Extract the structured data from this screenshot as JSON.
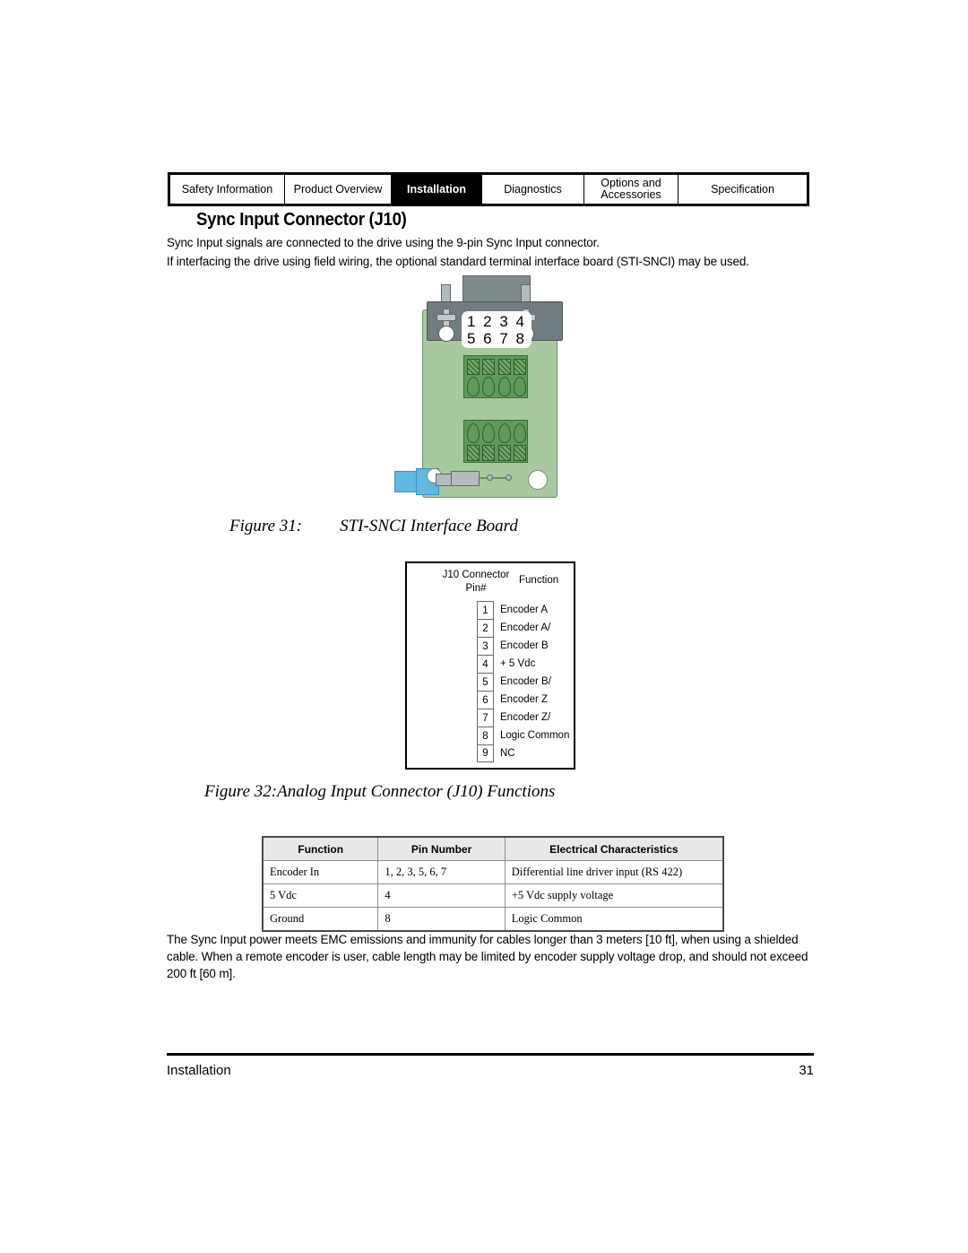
{
  "tabs": [
    {
      "label": "Safety Information",
      "active": false
    },
    {
      "label": "Product Overview",
      "active": false
    },
    {
      "label": "Installation",
      "active": true
    },
    {
      "label": "Diagnostics",
      "active": false
    },
    {
      "label": "Options and Accessories",
      "active": false
    },
    {
      "label": "Specification",
      "active": false
    }
  ],
  "heading": "Sync Input Connector (J10)",
  "intro": {
    "line1": "Sync Input signals are connected to the drive using the 9-pin Sync Input connector.",
    "line2": "If interfacing the drive using field wiring, the optional standard terminal interface board (STI-SNCI) may be used."
  },
  "pcb": {
    "pin_label_row1": "1 2 3 4",
    "pin_label_row2": "5 6 7 8"
  },
  "figure31": {
    "number": "Figure 31:",
    "title": "STI-SNCI Interface Board"
  },
  "figure32": {
    "caption": "Figure 32:Analog Input Connector (J10) Functions"
  },
  "pin_diagram": {
    "header_left_line1": "J10 Connector",
    "header_left_line2": "Pin#",
    "header_right": "Function",
    "rows": [
      {
        "pin": "1",
        "function": "Encoder A"
      },
      {
        "pin": "2",
        "function": "Encoder A/"
      },
      {
        "pin": "3",
        "function": "Encoder B"
      },
      {
        "pin": "4",
        "function": "+ 5 Vdc"
      },
      {
        "pin": "5",
        "function": "Encoder B/"
      },
      {
        "pin": "6",
        "function": "Encoder Z"
      },
      {
        "pin": "7",
        "function": "Encoder Z/"
      },
      {
        "pin": "8",
        "function": "Logic Common"
      },
      {
        "pin": "9",
        "function": "NC"
      }
    ]
  },
  "table": {
    "headers": [
      "Function",
      "Pin Number",
      "Electrical Characteristics"
    ],
    "rows": [
      [
        "Encoder In",
        "1, 2, 3, 5, 6, 7",
        "Differential line driver input (RS 422)"
      ],
      [
        "5 Vdc",
        "4",
        "+5 Vdc supply voltage"
      ],
      [
        "Ground",
        "8",
        "Logic Common"
      ]
    ]
  },
  "closing": "The Sync Input power meets EMC emissions and immunity for cables longer than 3 meters [10 ft], when using a shielded cable. When a remote encoder is user, cable length may be limited by encoder supply voltage drop, and should not exceed 200 ft [60 m].",
  "footer": {
    "section": "Installation",
    "page_number": "31"
  }
}
